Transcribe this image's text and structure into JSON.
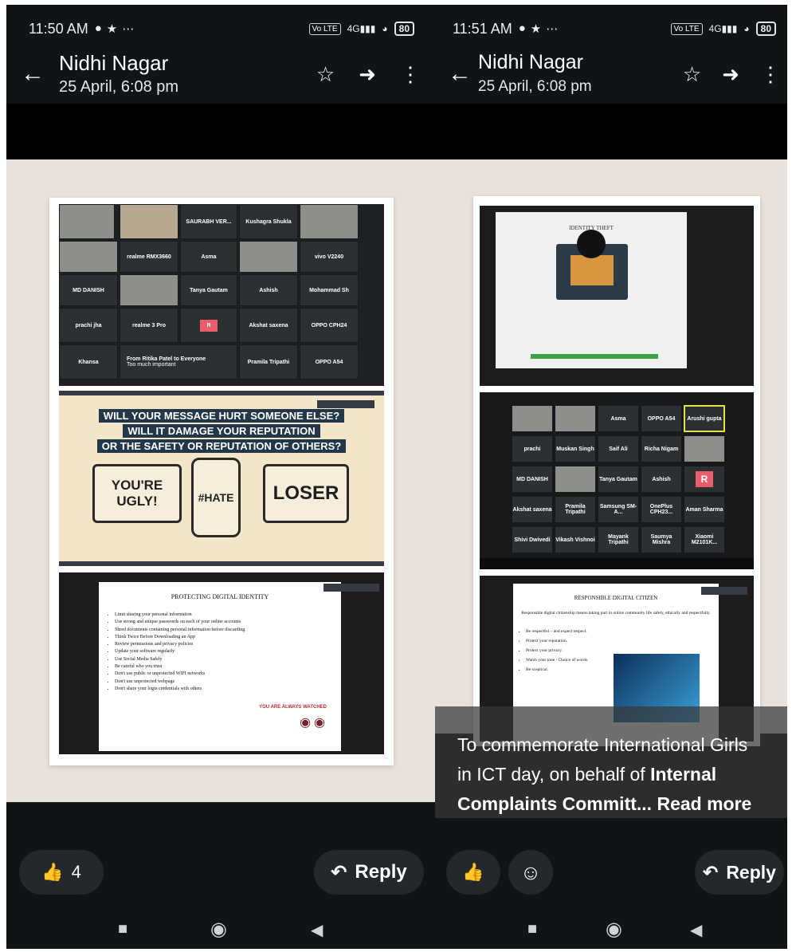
{
  "left": {
    "status": {
      "time": "11:50 AM",
      "battery": "80",
      "network": "4G",
      "volte": "Vo LTE"
    },
    "header": {
      "sender": "Nidhi Nagar",
      "datetime": "25 April, 6:08 pm"
    },
    "zoom_tiles": [
      "SAURABH VER...",
      "Kushagra Shukla",
      "realme RMX3660",
      "Asma",
      "vivo V2240",
      "MD DANISH",
      "Tanya Gautam",
      "Ashish",
      "Mohammad Sh",
      "prachi jha",
      "realme 3 Pro",
      "R",
      "Akshat saxena",
      "OPPO CPH24",
      "Khansa",
      "From Ritika Patel to Everyone",
      "Too much important",
      "Pramila Tripathi",
      "OPPO A54"
    ],
    "message_slide": {
      "lines": [
        "WILL YOUR MESSAGE HURT SOMEONE ELSE?",
        "WILL IT DAMAGE YOUR REPUTATION",
        "OR THE SAFETY OR REPUTATION OF OTHERS?"
      ],
      "screen1": "YOU'RE UGLY!",
      "screen2": "#HATE",
      "screen3": "LOSER"
    },
    "identity_slide": {
      "title": "PROTECTING DIGITAL IDENTITY",
      "bullets": [
        "Limit sharing your personal information",
        "Use strong and unique passwords on each of your online accounts",
        "Shred documents containing personal information before discarding",
        "Think Twice Before Downloading an App",
        "Review permissions and privacy policies",
        "Update your software regularly",
        "Use Social Media Safely",
        "Be careful who you trust",
        "Don't use public or unprotected WIFI networks",
        "Don't use unprotected webpage",
        "Don't share your login credentials with others"
      ],
      "watch_label": "YOU ARE ALWAYS WATCHED"
    },
    "reactions": {
      "count": "4"
    },
    "reply_label": "Reply"
  },
  "right": {
    "status": {
      "time": "11:51 AM",
      "battery": "80",
      "network": "4G",
      "volte": "Vo LTE"
    },
    "header": {
      "sender": "Nidhi Nagar",
      "datetime": "25 April, 6:08 pm"
    },
    "theft_title": "IDENTITY THEFT",
    "zoom_tiles": [
      "Asma",
      "OPPO A54",
      "Arushi gupta",
      "prachi",
      "Muskan Singh",
      "Saif Ali",
      "Richa Nigam",
      "MD DANISH",
      "Tanya Gautam",
      "Ashish",
      "R",
      "Akshat saxena",
      "Pramila Tripathi",
      "Samsung SM-A...",
      "OnePlus CPH23...",
      "Aman Sharma",
      "Shivi Dwivedi",
      "Vikash Vishnoi",
      "Mayank Tripathi",
      "Saumya Mishra",
      "Xiaomi M2101K..."
    ],
    "citizen_slide": {
      "title": "RESPONSIBLE DIGITAL CITIZEN",
      "intro": "Responsible digital citizenship means taking part in online community life safely, ethically and respectfully.",
      "bullets": [
        "Be respectful – and expect respect.",
        "Protect your reputation.",
        "Protect your privacy.",
        "Watch your tone / Choice of words.",
        "Be sceptical."
      ]
    },
    "caption": {
      "plain": "To commemorate International Girls in ICT day, on behalf of ",
      "bold": "Internal Complaints Committ...",
      "more": " Read more"
    },
    "reply_label": "Reply"
  },
  "colors": {
    "bar": "#0f1417",
    "pill": "#22282b",
    "zoom_r": "#e95d6d",
    "slide_bg": "#f3e5c9",
    "banner": "#22374a"
  }
}
